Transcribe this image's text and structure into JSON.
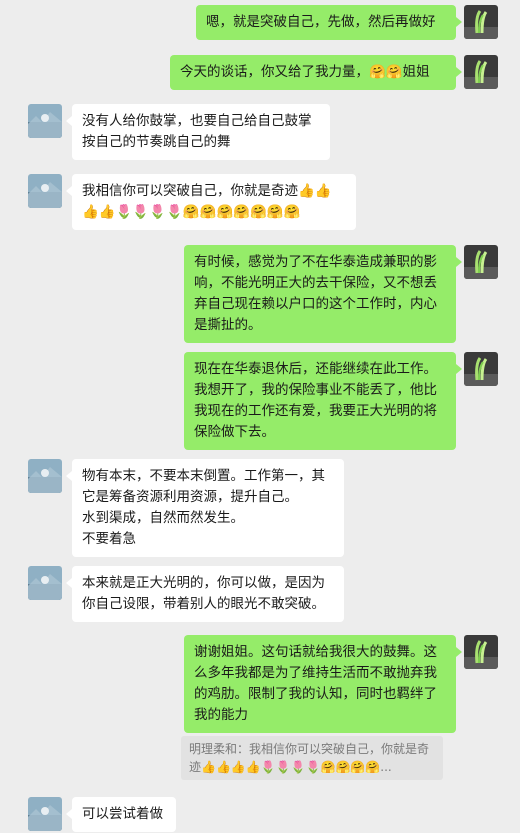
{
  "colors": {
    "background": "#ededed",
    "my_bubble": "#95ec69",
    "their_bubble": "#ffffff",
    "quote_bg": "#e2e2e2"
  },
  "avatars": {
    "me": "green-sprout-avatar",
    "them": "blue-landscape-avatar"
  },
  "messages": [
    {
      "sender": "me",
      "text": "嗯，就是突破自己，先做，然后再做好"
    },
    {
      "sender": "me",
      "text": "今天的谈话，你又给了我力量，🤗🤗姐姐"
    },
    {
      "sender": "them",
      "text": "没有人给你鼓掌，也要自己给自己鼓掌\n按自己的节奏跳自己的舞"
    },
    {
      "sender": "them",
      "text": "我相信你可以突破自己，你就是奇迹👍👍\n👍👍🌷🌷🌷🌷🤗🤗🤗🤗🤗🤗🤗"
    },
    {
      "sender": "me",
      "text": "有时候，感觉为了不在华泰造成兼职的影\n响，不能光明正大的去干保险，又不想丢\n弃自己现在赖以户口的这个工作时，内心\n是撕扯的。"
    },
    {
      "sender": "me",
      "text": "现在在华泰退休后，还能继续在此工作。\n我想开了，我的保险事业不能丢了，他比\n我现在的工作还有爱，我要正大光明的将\n保险做下去。"
    },
    {
      "sender": "them",
      "text": "物有本末，不要本末倒置。工作第一，其\n它是筹备资源利用资源，提升自己。\n水到渠成，自然而然发生。\n不要着急"
    },
    {
      "sender": "them",
      "text": "本来就是正大光明的，你可以做，是因为\n你自己设限，带着别人的眼光不敢突破。"
    },
    {
      "sender": "me",
      "text": "谢谢姐姐。这句话就给我很大的鼓舞。这\n么多年我都是为了维持生活而不敢抛弃我\n的鸡肋。限制了我的认知，同时也羁绊了\n我的能力"
    },
    {
      "sender": "them",
      "text": "可以尝试着做"
    }
  ],
  "quote": {
    "text": "明理柔和：我相信你可以突破自己，你就是奇\n迹👍👍👍👍🌷🌷🌷🌷🤗🤗🤗🤗..."
  }
}
